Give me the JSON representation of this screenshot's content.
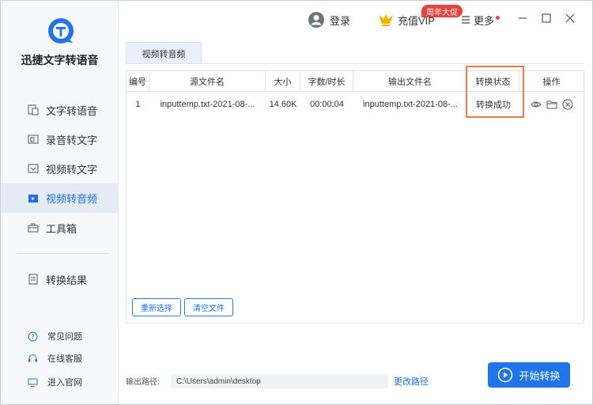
{
  "app": {
    "name": "迅捷文字转语音"
  },
  "sidebar": {
    "items": [
      {
        "label": "文字转语音",
        "icon": "text-to-speech-icon"
      },
      {
        "label": "录音转文字",
        "icon": "recording-icon"
      },
      {
        "label": "视频转文字",
        "icon": "video-text-icon"
      },
      {
        "label": "视频转音频",
        "icon": "video-audio-icon"
      },
      {
        "label": "工具箱",
        "icon": "toolbox-icon"
      },
      {
        "label": "转换结果",
        "icon": "result-icon"
      }
    ],
    "footer": [
      {
        "label": "常见问题",
        "icon": "question-icon"
      },
      {
        "label": "在线客服",
        "icon": "headset-icon"
      },
      {
        "label": "进入官网",
        "icon": "monitor-icon"
      }
    ]
  },
  "topbar": {
    "login": "登录",
    "vip": "充值VIP",
    "promo": "周年大促",
    "more": "更多"
  },
  "tabs": [
    {
      "label": "视频转音频"
    }
  ],
  "table": {
    "headers": [
      "编号",
      "源文件名",
      "大小",
      "字数/时长",
      "输出文件名",
      "转换状态",
      "操作"
    ],
    "rows": [
      {
        "id": "1",
        "source": "inputtemp.txt-2021-08-...",
        "size": "14.60K",
        "duration": "00:00:04",
        "output": "inputtemp.txt-2021-08-...",
        "status": "转换成功"
      }
    ]
  },
  "buttons": {
    "reselect": "重新选择",
    "clear": "清空文件",
    "change_path": "更改路径",
    "start": "开始转换"
  },
  "output": {
    "label": "输出路径:",
    "path": "C:\\Users\\admin\\desktop"
  },
  "colors": {
    "accent": "#1f74ea",
    "highlight": "#f07a3f",
    "badge": "#e8423c"
  }
}
